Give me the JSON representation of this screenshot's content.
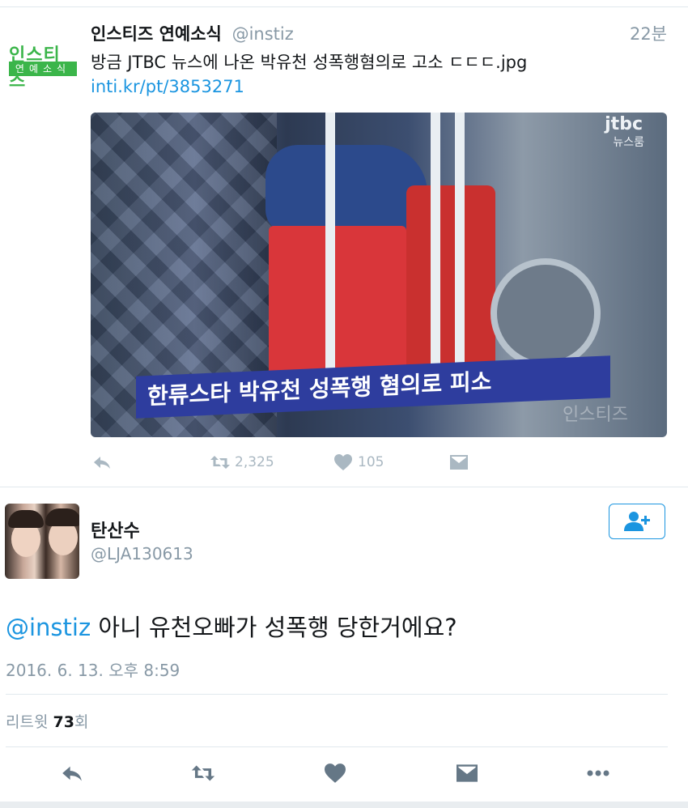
{
  "tweet1": {
    "display_name": "인스티즈 연예소식",
    "handle": "@instiz",
    "time": "22분",
    "avatar_logo_top": "인스티즈",
    "avatar_logo_bottom": "연예소식",
    "text": "방금 JTBC 뉴스에 나온 박유천 성폭행혐의로 고소 ㄷㄷㄷ.jpg ",
    "link": "inti.kr/pt/3853271",
    "media": {
      "caption": "한류스타 박유천 성폭행 혐의로 피소",
      "channel_logo": "jtbc",
      "channel_sub": "뉴스룸",
      "watermark": "인스티즈"
    },
    "actions": {
      "retweet_count": "2,325",
      "like_count": "105"
    }
  },
  "tweet2": {
    "display_name": "탄산수",
    "handle": "@LJA130613",
    "mention": "@instiz",
    "text": " 아니 유천오빠가 성폭행 당한거에요?",
    "date": "2016. 6. 13. 오후 8:59",
    "retweets_label": "리트윗 ",
    "retweets_count": "73",
    "retweets_suffix": "회"
  },
  "colors": {
    "link": "#1b95e0",
    "muted": "#8899a6",
    "brand_green": "#3bb54a",
    "caption_blue": "#2e3d9e"
  },
  "icons": [
    "reply-icon",
    "retweet-icon",
    "heart-icon",
    "direct-message-icon",
    "more-icon",
    "follow-user-icon"
  ]
}
